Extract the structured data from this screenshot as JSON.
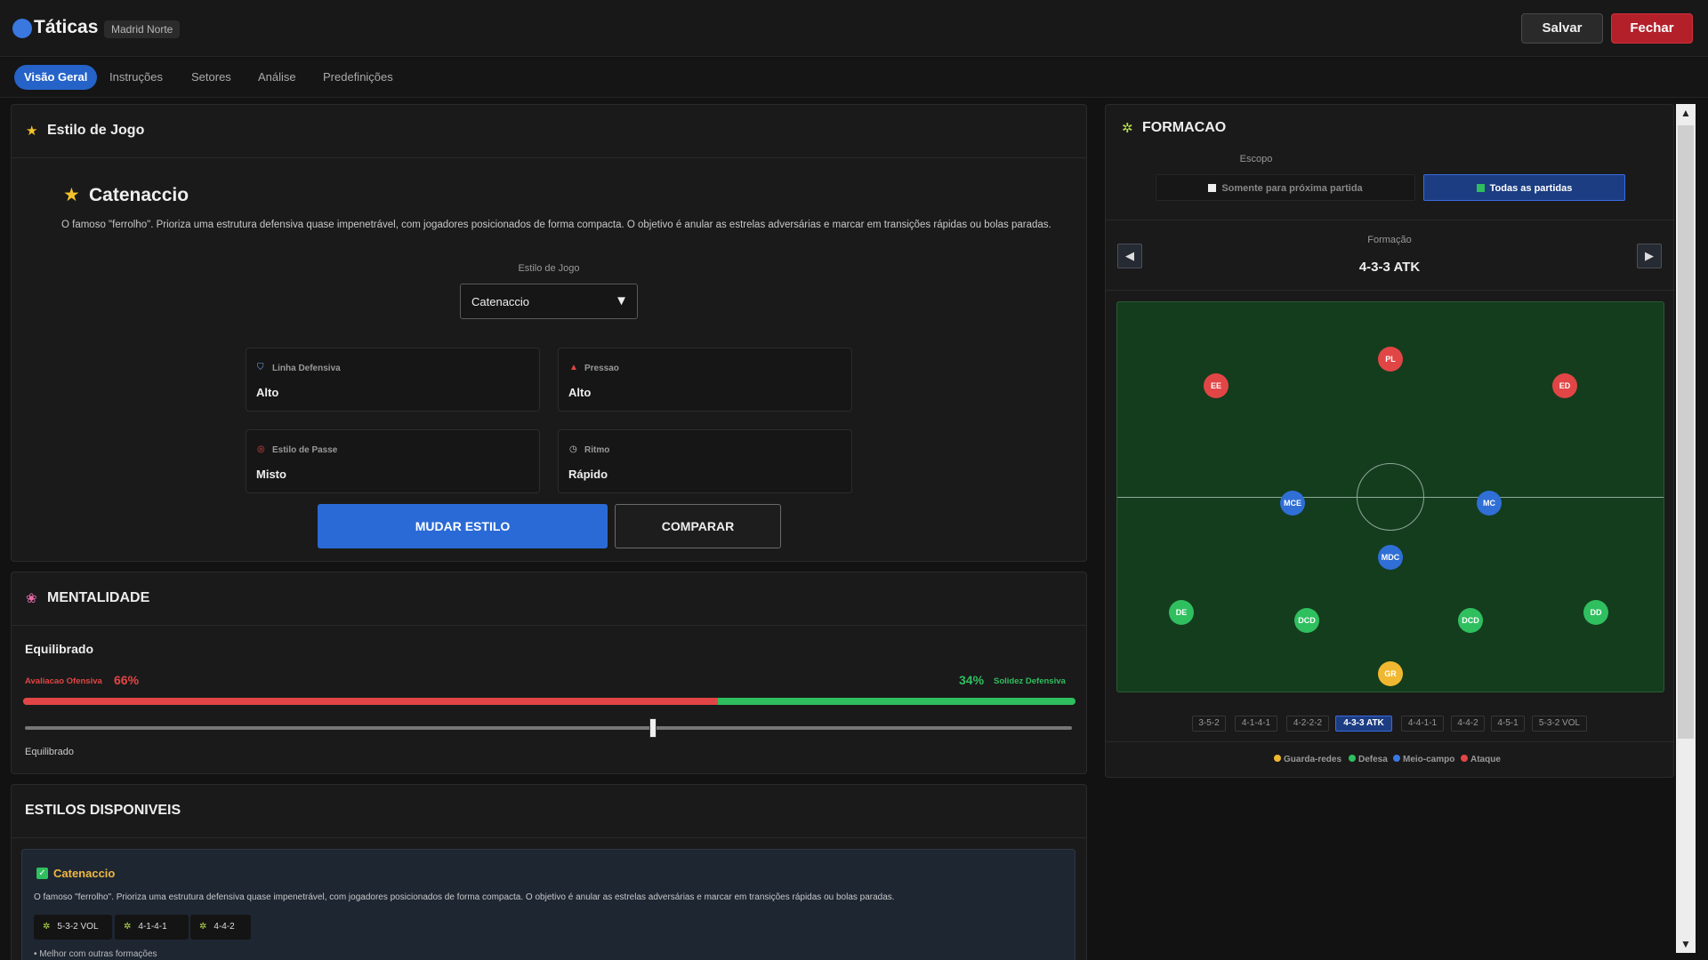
{
  "header": {
    "title": "Táticas",
    "team": "Madrid Norte",
    "save": "Salvar",
    "close": "Fechar"
  },
  "tabs": [
    "Visão Geral",
    "Instruções",
    "Setores",
    "Análise",
    "Predefinições"
  ],
  "play_style": {
    "section_title": "Estilo de Jogo",
    "name": "Catenaccio",
    "description": "O famoso \"ferrolho\". Prioriza uma estrutura defensiva quase impenetrável, com jogadores posicionados de forma compacta. O objetivo é anular as estrelas adversárias e marcar em transições rápidas ou bolas paradas.",
    "select_label": "Estilo de Jogo",
    "select_value": "Catenaccio",
    "attributes": [
      {
        "label": "Linha Defensiva",
        "value": "Alto",
        "icon": "shield-icon"
      },
      {
        "label": "Pressao",
        "value": "Alto",
        "icon": "flame-icon"
      },
      {
        "label": "Estilo de Passe",
        "value": "Misto",
        "icon": "target-icon"
      },
      {
        "label": "Ritmo",
        "value": "Rápido",
        "icon": "clock-icon"
      }
    ],
    "change_button": "MUDAR ESTILO",
    "compare_button": "COMPARAR"
  },
  "mentality": {
    "section_title": "MENTALIDADE",
    "current": "Equilibrado",
    "offensive_label": "Avaliacao Ofensiva",
    "offensive_pct": "66%",
    "offensive_value": 66,
    "defensive_label": "Solidez Defensiva",
    "defensive_pct": "34%",
    "slider_value": 0.6,
    "slider_label": "Equilibrado"
  },
  "styles_available": {
    "section_title": "ESTILOS DISPONIVEIS",
    "items": [
      {
        "name": "Catenaccio",
        "checked": true,
        "description": "O famoso \"ferrolho\". Prioriza uma estrutura defensiva quase impenetrável, com jogadores posicionados de forma compacta. O objetivo é anular as estrelas adversárias e marcar em transições rápidas ou bolas paradas.",
        "formations": [
          "5-3-2 VOL",
          "4-1-4-1",
          "4-4-2"
        ],
        "footer": "• Melhor com outras formações"
      }
    ]
  },
  "formation": {
    "section_title": "FORMACAO",
    "scope_label": "Escopo",
    "scope_options": [
      {
        "label": "Somente para próxima partida",
        "selected": false
      },
      {
        "label": "Todas as partidas",
        "selected": true
      }
    ],
    "label": "Formação",
    "current": "4-3-3 ATK",
    "players": [
      {
        "pos": "PL",
        "role": "attack"
      },
      {
        "pos": "EE",
        "role": "attack"
      },
      {
        "pos": "ED",
        "role": "attack"
      },
      {
        "pos": "MCE",
        "role": "midfield"
      },
      {
        "pos": "MC",
        "role": "midfield"
      },
      {
        "pos": "MDC",
        "role": "midfield"
      },
      {
        "pos": "DE",
        "role": "defense"
      },
      {
        "pos": "DCD",
        "role": "defense"
      },
      {
        "pos": "DCD",
        "role": "defense"
      },
      {
        "pos": "DD",
        "role": "defense"
      },
      {
        "pos": "GR",
        "role": "goalkeeper"
      }
    ],
    "options": [
      "3-5-2",
      "4-1-4-1",
      "4-2-2-2",
      "4-3-3 ATK",
      "4-4-1-1",
      "4-4-2",
      "4-5-1",
      "5-3-2 VOL"
    ],
    "legend": [
      {
        "label": "Guarda-redes",
        "color": "#f0b830"
      },
      {
        "label": "Defesa",
        "color": "#2fbf5f"
      },
      {
        "label": "Meio-campo",
        "color": "#3a78e0"
      },
      {
        "label": "Ataque",
        "color": "#e24545"
      }
    ]
  },
  "colors": {
    "accent": "#2563c9",
    "attack": "#e24545",
    "defense": "#2fbf5f",
    "midfield": "#2f6fd6",
    "goalkeeper": "#f0b830"
  }
}
